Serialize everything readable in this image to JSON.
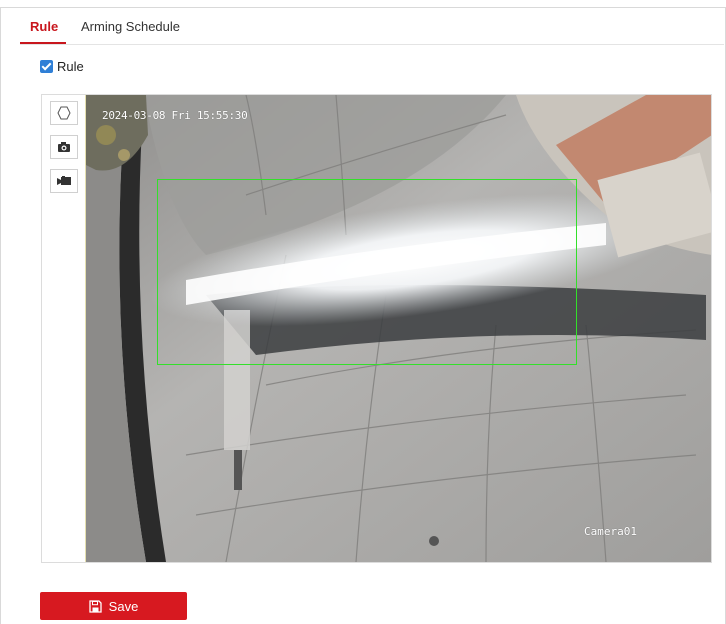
{
  "tabs": [
    {
      "label": "Rule",
      "active": true
    },
    {
      "label": "Arming Schedule",
      "active": false
    }
  ],
  "rule_checkbox": {
    "label": "Rule",
    "checked": true
  },
  "toolbar": {
    "tools": [
      {
        "name": "polygon-icon"
      },
      {
        "name": "camera-icon"
      },
      {
        "name": "video-camera-icon"
      }
    ]
  },
  "video": {
    "osd_timestamp": "2024-03-08  Fri 15:55:30",
    "osd_camera_name": "Camera01"
  },
  "save_button": {
    "label": "Save",
    "icon": "floppy-disk-icon"
  },
  "colors": {
    "accent": "#c8161d",
    "save_button": "#d71920",
    "checkbox": "#2f7fd6",
    "detection_region": "#33e02a"
  }
}
